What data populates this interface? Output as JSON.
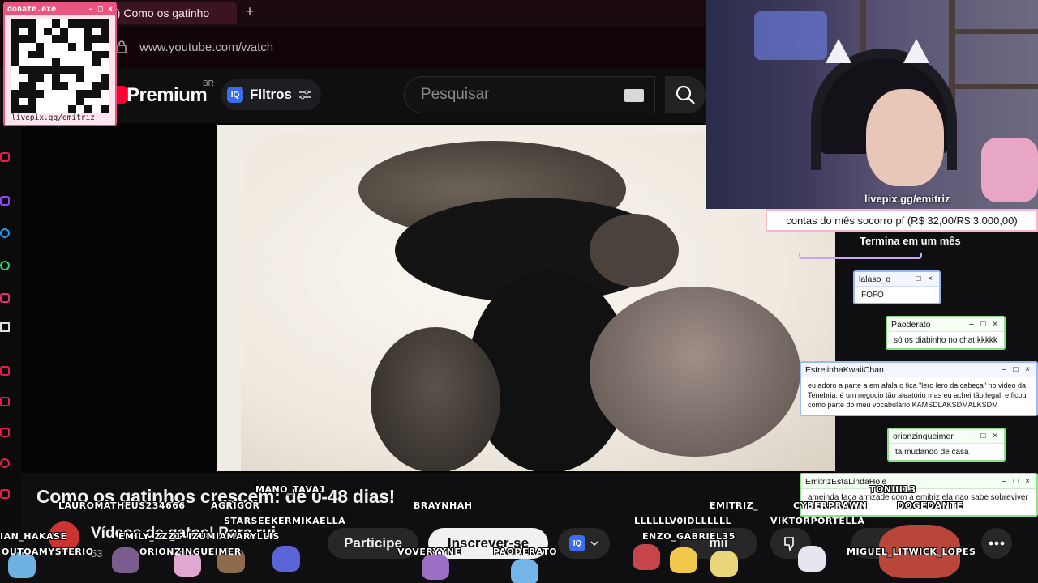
{
  "browser": {
    "tab_title": "2) Como os gatinho",
    "url": "www.youtube.com/watch"
  },
  "youtube": {
    "logo_text": "Premium",
    "region": "BR",
    "filters_label": "Filtros",
    "iq_badge": "IQ",
    "search_placeholder": "Pesquisar",
    "video_title": "Como os gatinhos crescem: de 0-48 dias!",
    "channel_name": "Vídeos de gatos! Para rui",
    "subscribers": "53",
    "join_label": "Participe",
    "subscribe_label": "Inscrever-se",
    "likes_label": "mil",
    "share_label": "Co"
  },
  "overlay": {
    "donate_title": "donate.exe",
    "donate_controls": "- □ ×",
    "donate_url": "livepix.gg/emitriz",
    "cam_url": "livepix.gg/emitriz",
    "goal_text": "contas do mês socorro pf (R$ 32,00/R$ 3.000,00)",
    "goal_end": "Termina em um mês",
    "goal_progress": 0.0107
  },
  "chats": [
    {
      "user": "lalaso_o",
      "text": "FOFO",
      "style": "blue"
    },
    {
      "user": "Paoderato",
      "text": "só os diabinho no chat kkkkk",
      "style": "green"
    },
    {
      "user": "EstrelinhaKwaiiChan",
      "text": "eu adoro a parte a em afala q fica \"lero lero da cabeça\" no video da Tenebria. é um negocio tão aleatório mas eu achei tão legal, e ficou como parte do meu vocabulário KAMSDLAKSDMALKSDM",
      "style": "blue"
    },
    {
      "user": "orionzingueimer",
      "text": "ta mudando de casa",
      "style": "green"
    },
    {
      "user": "EmitrizEstaLindaHoje",
      "text": "ameinda faça amizade com a emitriz ela nao sabe sobreviver",
      "style": "green"
    }
  ],
  "chat_controls": "– □ ×",
  "viewers": [
    "MANO_TAVA1",
    "LAUROMATHEUS234666",
    "AGRIGOR",
    "BRAYNHAH",
    "STARSEEKERMIKAELLA",
    "IAN_HAKASE",
    "EMILY_ZZZ1",
    "IZUMIAMARYLLIS",
    "OUTOAMYSTERIO",
    "ORIONZINGUEIMER",
    "VOVERYYNE",
    "PAODERATO",
    "EMITRIZ_",
    "CYBERPRAWN",
    "TONIII13",
    "DOGEDANTE",
    "LLLLLLV0IDLLLLLL",
    "VIKTORPORTELLA",
    "ENZO_GABRIEL35",
    "MIGUEL_LITWICK_LOPES"
  ],
  "icons": {
    "newtab": "+",
    "search": "search-icon",
    "filters": "sliders-icon",
    "chevron": "chevron-down-icon",
    "more": "more-icon"
  },
  "colors": {
    "accent_pink": "#e8557f",
    "chat_green": "#8fe08a",
    "chat_blue": "#9db7f5",
    "yt_red": "#ff0033"
  }
}
